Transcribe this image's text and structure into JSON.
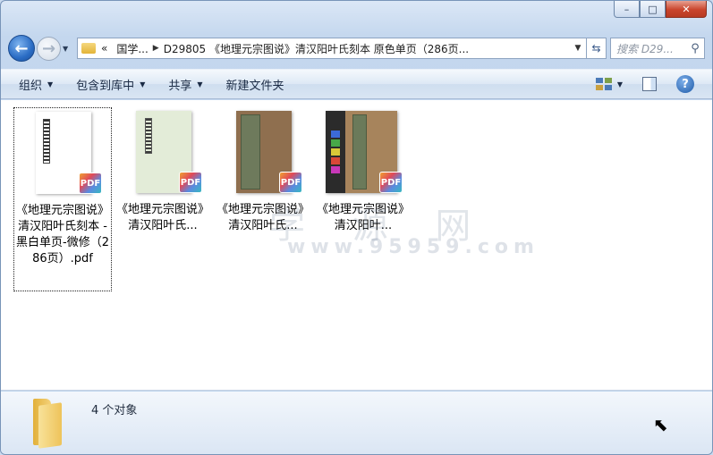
{
  "window": {
    "caption": {
      "minimize": "–",
      "maximize": "□",
      "close": "✕"
    }
  },
  "address": {
    "chevron": "«",
    "crumb1": "国学...",
    "crumb2": "D29805 《地理元宗图说》清汉阳叶氏刻本 原色单页（286页...",
    "search_placeholder": "搜索 D29..."
  },
  "toolbar": {
    "organize": "组织",
    "include_library": "包含到库中",
    "share": "共享",
    "new_folder": "新建文件夹"
  },
  "items": [
    {
      "label": "《地理元宗图说》清汉阳叶氏刻本 -黑白单页-微修（286页）.pdf",
      "badge": "PDF"
    },
    {
      "label": "《地理元宗图说》清汉阳叶氏...",
      "badge": "PDF"
    },
    {
      "label": "《地理元宗图说》清汉阳叶氏...",
      "badge": "PDF"
    },
    {
      "label": "《地理元宗图说》清汉阳叶...",
      "badge": "PDF"
    }
  ],
  "watermark": {
    "line1": "学 源 网",
    "line2": "www.95959.com"
  },
  "status": {
    "count_text": "4 个对象"
  },
  "colors": {
    "accent": "#2a6cc4",
    "close": "#c9442c"
  }
}
